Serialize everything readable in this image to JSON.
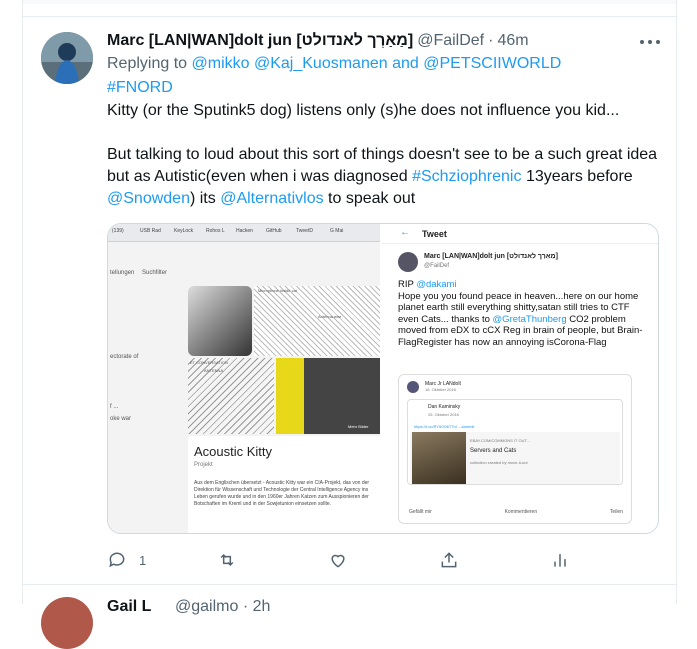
{
  "tweet": {
    "display_name": "Marc [LAN|WAN]dolt jun [מַאַרְך לאנדולט]",
    "handle": "@FailDef",
    "dot": "·",
    "time": "46m",
    "reply_prefix": "Replying to",
    "reply_to_1": "@mikko",
    "reply_to_2": "@Kaj_Kuosmanen",
    "reply_and": "and",
    "reply_to_3": "@PETSCIIWORLD",
    "hashtag_fnord": "#FNORD",
    "line1": "Kitty (or the Sputink5 dog) listens only (s)he does not influence you kid...",
    "line2_a": "But talking to loud about this sort of things doesn't see to be a such great idea but as Autistic(even when i was diagnosed",
    "line2_hashtag": "#Schziophrenic",
    "line2_b": "13years before",
    "line2_mention1": "@Snowden",
    "line2_c": ") its",
    "line2_mention2": "@Alternativlos",
    "line2_d": "to speak out"
  },
  "media": {
    "left": {
      "tabs": [
        "(139)",
        "USB Rad",
        "KeyLock",
        "Rohos L",
        "Hacken",
        "GitHub",
        "TweetD",
        "G Mai"
      ],
      "sidebar": [
        "tellungen",
        "Suchfilter",
        "ectorate of",
        "f ...",
        "oke war"
      ],
      "labels": [
        "Microphone inside cat",
        "Antenna wire",
        "ET CONVERSATION",
        "ANTENNA",
        "Mehr Bilder"
      ],
      "card_title": "Acoustic Kitty",
      "card_subtitle": "Projekt",
      "card_desc": "Aus dem Englischen übersetzt - Acoustic Kitty war ein CIA-Projekt, das von der Direktion für Wissenschaft und Technologie der Central Intelligence Agency ins Leben gerufen wurde und in den 1960er Jahren Katzen zum Ausspionieren der Botschaften im Kreml und in der Sowjetunion einsetzen sollte."
    },
    "right": {
      "back_arrow": "←",
      "title": "Tweet",
      "name": "Marc [LAN|WAN]dolt jun [מַאַרְך לאנדולט]",
      "handle": "@FailDef",
      "text_prefix": "RIP",
      "text_mention": "@dakami",
      "text_body_1": "Hope you you found peace in heaven...here on our home planet earth still everything shitty,satan still tries to CTF even Cats... thanks to",
      "text_mention2": "@GretaThunberg",
      "text_body_2": "CO2 problem moved from eDX to cCX Reg in brain of people, but Brain-FlagRegister has now an annoying isCorona-Flag",
      "quote_name": "Marc Jr LANdolt",
      "quote_date": "16. Oktober 2016",
      "inner_name": "Dan Kaminsky",
      "inner_date": "25. Oktober 2016",
      "inner_link": "https://t.co/RY5O96T7hI ...dammit",
      "card_source": "EBAY.COM/COMMONS IT OUT...",
      "card_title": "Servers and Cats",
      "card_sub": "collection created by move-it-out",
      "quote_actions": [
        "Gefällt mir",
        "Kommentieren",
        "Teilen"
      ]
    }
  },
  "actions": {
    "reply_count": "1"
  },
  "next_tweet": {
    "name": "Gail L",
    "handle": "@gailmo · 2h"
  }
}
